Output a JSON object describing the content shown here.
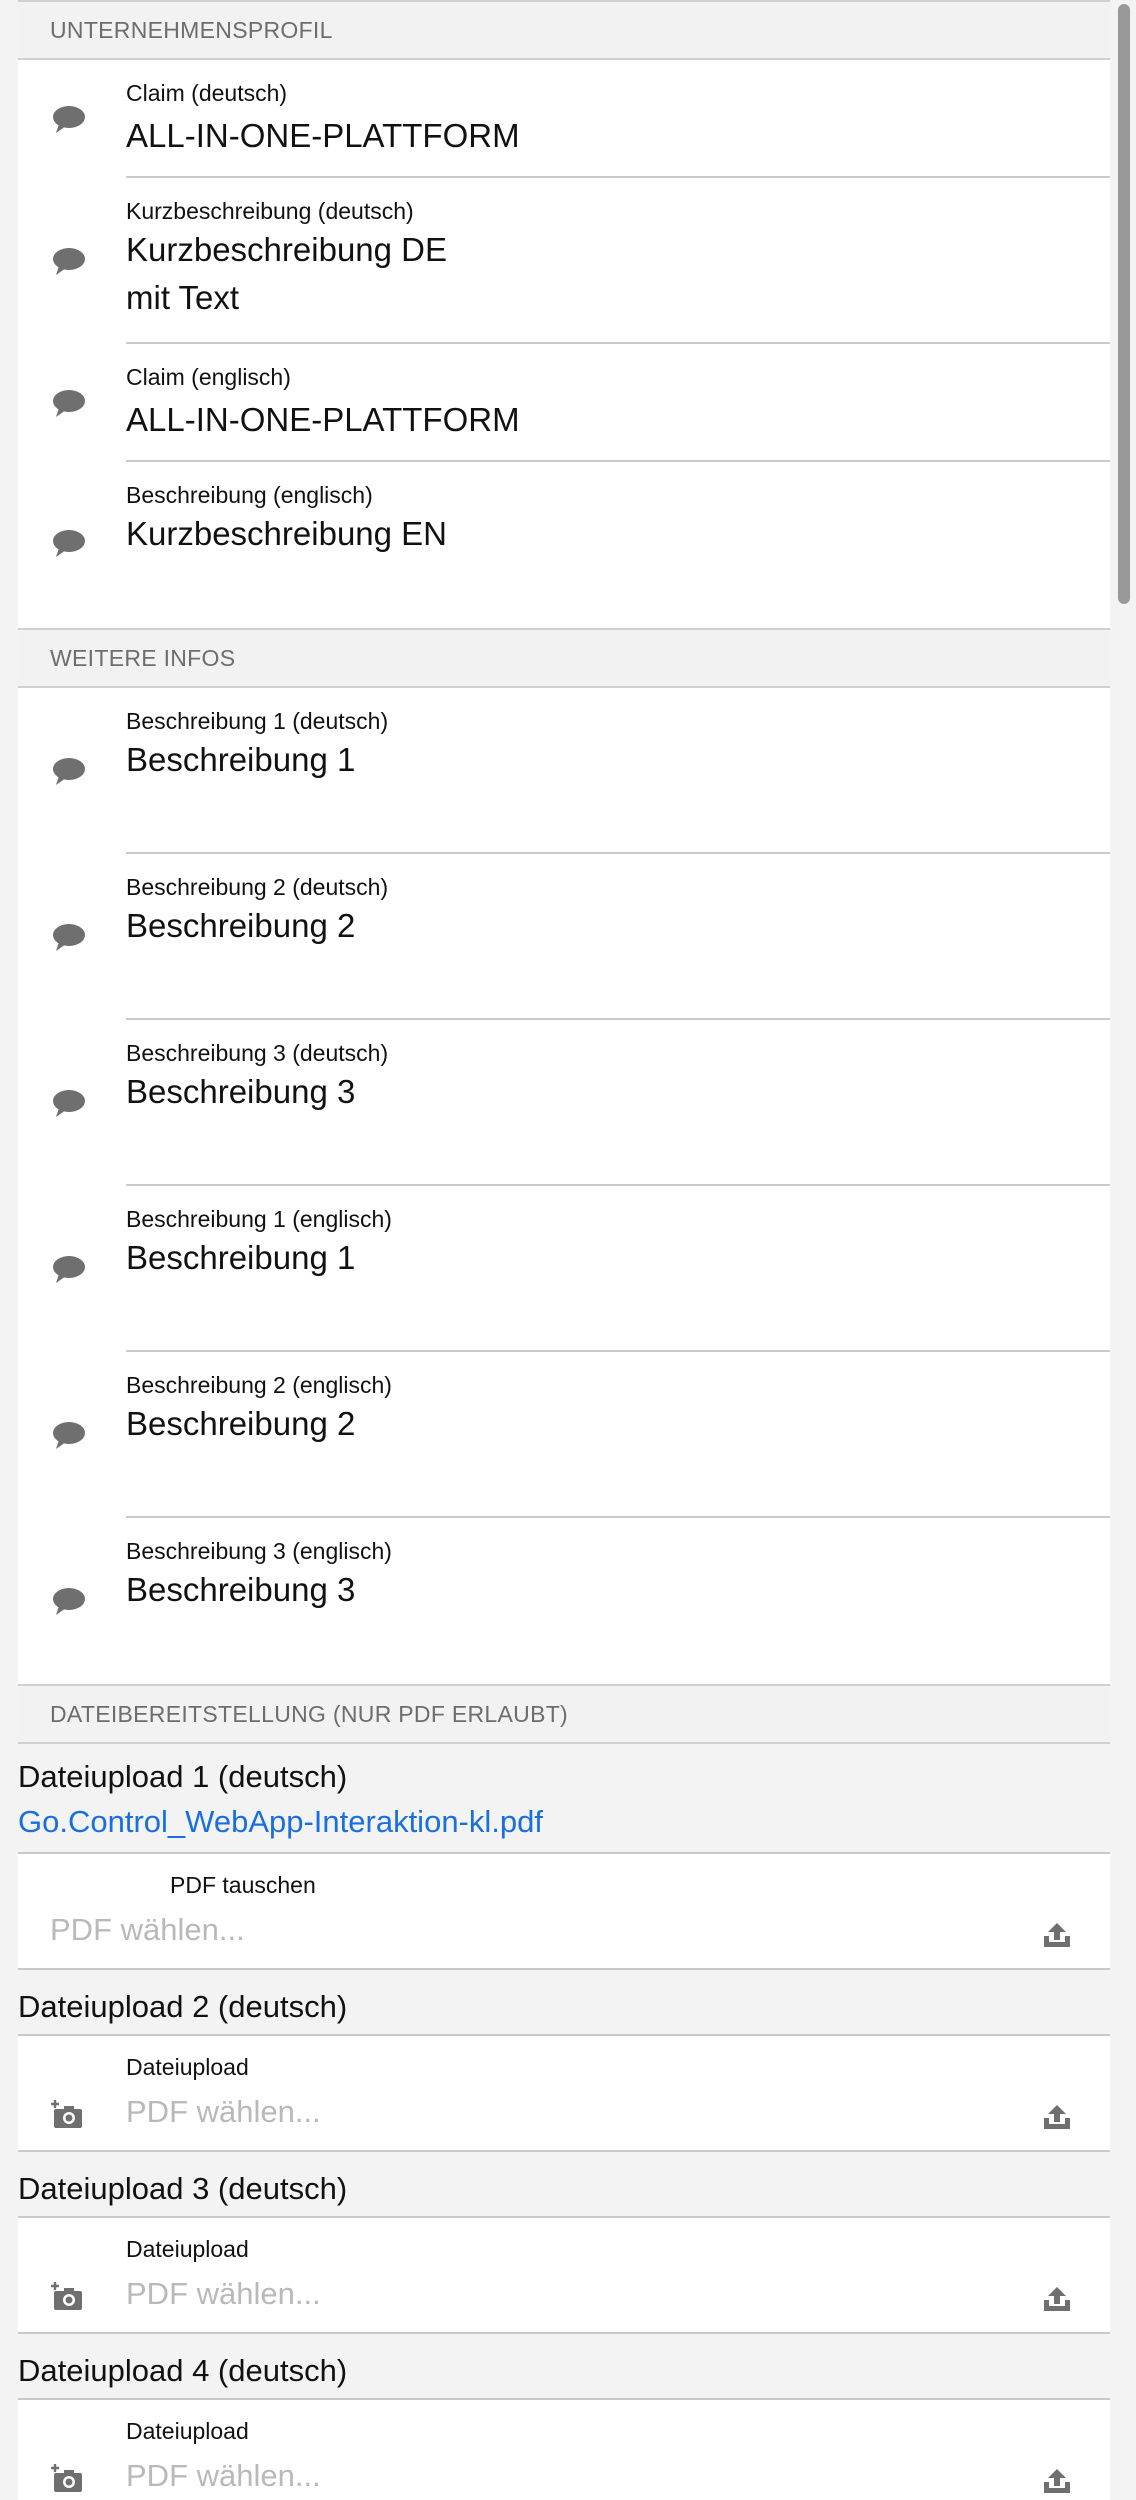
{
  "sections": {
    "profile": {
      "header": "UNTERNEHMENSPROFIL",
      "fields": [
        {
          "label": "Claim (deutsch)",
          "value": "ALL-IN-ONE-PLATTFORM"
        },
        {
          "label": "Kurzbeschreibung (deutsch)",
          "value": "Kurzbeschreibung DE",
          "value2": "mit Text"
        },
        {
          "label": "Claim (englisch)",
          "value": "ALL-IN-ONE-PLATTFORM"
        },
        {
          "label": "Beschreibung (englisch)",
          "value": "Kurzbeschreibung EN"
        }
      ]
    },
    "more": {
      "header": "WEITERE INFOS",
      "fields": [
        {
          "label": "Beschreibung 1 (deutsch)",
          "value": "Beschreibung 1"
        },
        {
          "label": "Beschreibung 2 (deutsch)",
          "value": "Beschreibung 2"
        },
        {
          "label": "Beschreibung 3 (deutsch)",
          "value": "Beschreibung 3"
        },
        {
          "label": "Beschreibung 1 (englisch)",
          "value": "Beschreibung 1"
        },
        {
          "label": "Beschreibung 2 (englisch)",
          "value": "Beschreibung 2"
        },
        {
          "label": "Beschreibung 3 (englisch)",
          "value": "Beschreibung 3"
        }
      ]
    },
    "files": {
      "header": "DATEIBEREITSTELLUNG (NUR PDF ERLAUBT)",
      "uploads": [
        {
          "title": "Dateiupload 1 (deutsch)",
          "file_link": "Go.Control_WebApp-Interaktion-kl.pdf",
          "label": "PDF tauschen",
          "placeholder": "PDF wählen..."
        },
        {
          "title": "Dateiupload 2 (deutsch)",
          "label": "Dateiupload",
          "placeholder": "PDF wählen..."
        },
        {
          "title": "Dateiupload 3 (deutsch)",
          "label": "Dateiupload",
          "placeholder": "PDF wählen..."
        },
        {
          "title": "Dateiupload 4 (deutsch)",
          "label": "Dateiupload",
          "placeholder": "PDF wählen..."
        }
      ]
    }
  },
  "icons": {
    "comment": "comment-icon",
    "camera": "camera-add-icon",
    "upload": "upload-icon"
  },
  "colors": {
    "link": "#1a6fe0",
    "icon": "#6f6f6f",
    "placeholder": "#b9b9b9"
  }
}
